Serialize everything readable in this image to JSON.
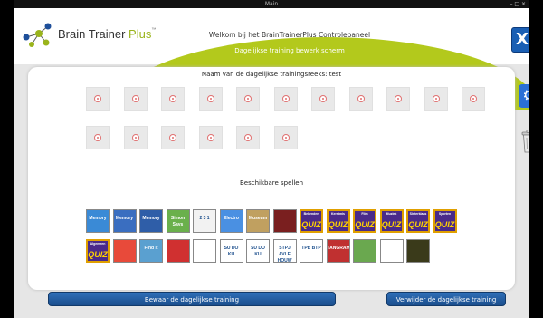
{
  "window": {
    "title": "Main",
    "controls": "–  □  ×"
  },
  "logo": {
    "brand": "Brain Trainer",
    "suffix": "Plus",
    "tm": "™"
  },
  "header": {
    "welcome": "Welkom bij het BrainTrainerPlus Controlepaneel",
    "subtitle": "Dagelijkse training bewerk scherm",
    "close_label": "X"
  },
  "series": {
    "title": "Naam van de dagelijkse trainingsreeks: test",
    "slot_count": 17
  },
  "available": {
    "title": "Beschikbare spellen",
    "games_row1": [
      {
        "id": "memory-1",
        "label": "Memory",
        "color": "#3a8ad6"
      },
      {
        "id": "memory-2",
        "label": "Memory",
        "color": "#3a6ec0"
      },
      {
        "id": "memory-3",
        "label": "Memory",
        "color": "#2f5ea8"
      },
      {
        "id": "simon-says",
        "label": "Simon Says",
        "color": "#6ab04c"
      },
      {
        "id": "sequence",
        "label": "2 3 1",
        "color": "#f2f2f2"
      },
      {
        "id": "electro",
        "label": "Electro",
        "color": "#4a90e2"
      },
      {
        "id": "museum",
        "label": "Museum",
        "color": "#c0a060"
      },
      {
        "id": "masks",
        "label": "",
        "color": "#7a1f1f"
      },
      {
        "id": "quiz-bekenden",
        "label": "QUIZ",
        "topic": "Bekenden",
        "color": "#4a2a8a"
      },
      {
        "id": "quiz-kerstmis",
        "label": "QUIZ",
        "topic": "Kerstmis",
        "color": "#4a2a8a"
      },
      {
        "id": "quiz-film",
        "label": "QUIZ",
        "topic": "Film",
        "color": "#4a2a8a"
      },
      {
        "id": "quiz-muziek",
        "label": "QUIZ",
        "topic": "Muziek",
        "color": "#4a2a8a"
      },
      {
        "id": "quiz-sinterklaas",
        "label": "QUIZ",
        "topic": "Sinterklaas",
        "color": "#4a2a8a"
      },
      {
        "id": "quiz-sporten",
        "label": "QUIZ",
        "topic": "Sporten",
        "color": "#4a2a8a"
      }
    ],
    "games_row2": [
      {
        "id": "quiz-algemeen",
        "label": "QUIZ",
        "topic": "Algemeen",
        "color": "#4a2a8a"
      },
      {
        "id": "puzzle",
        "label": "",
        "color": "#e84a3a"
      },
      {
        "id": "find-it",
        "label": "Find it",
        "color": "#5aa0d0"
      },
      {
        "id": "connect-four",
        "label": "",
        "color": "#d03030"
      },
      {
        "id": "tower-hanoi",
        "label": "",
        "color": "#ffffff"
      },
      {
        "id": "sudoku-1",
        "label": "SU DO KU",
        "color": "#ffffff"
      },
      {
        "id": "sudoku-2",
        "label": "SU DO KU",
        "color": "#ffffff"
      },
      {
        "id": "word-grid",
        "label": "STPJ AVLE HOUW GRSK",
        "color": "#ffffff"
      },
      {
        "id": "tpb-btp",
        "label": "TPB BTP",
        "color": "#ffffff"
      },
      {
        "id": "tangram",
        "label": "TANGRAM",
        "color": "#c03030"
      },
      {
        "id": "landscape",
        "label": "",
        "color": "#6aa84f"
      },
      {
        "id": "mole",
        "label": "",
        "color": "#ffffff"
      },
      {
        "id": "lantern",
        "label": "",
        "color": "#3a3a1a"
      }
    ]
  },
  "actions": {
    "save_label": "Bewaar de dagelijkse training",
    "delete_label": "Verwijder de dagelijkse training"
  },
  "colors": {
    "accent_green": "#b3c91c",
    "button_blue": "#1b4e8c",
    "close_blue": "#1a5fb4"
  }
}
